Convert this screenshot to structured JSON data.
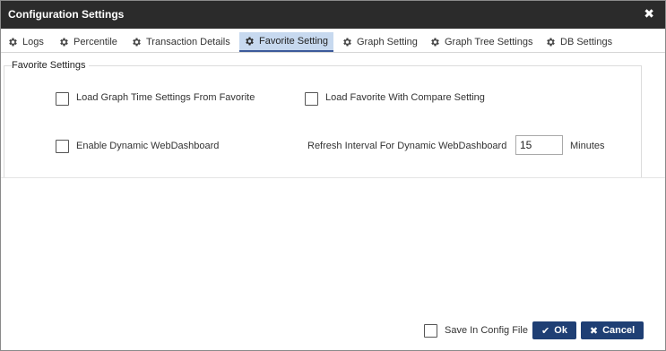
{
  "dialog": {
    "title": "Configuration Settings"
  },
  "tabs": [
    {
      "label": "Logs",
      "icon": "gear-icon"
    },
    {
      "label": "Percentile",
      "icon": "gear-icon"
    },
    {
      "label": "Transaction Details",
      "icon": "gear-icon"
    },
    {
      "label": "Favorite Setting",
      "icon": "gear-icon",
      "active": true
    },
    {
      "label": "Graph Setting",
      "icon": "gear-icon"
    },
    {
      "label": "Graph Tree Settings",
      "icon": "gear-icon"
    },
    {
      "label": "DB Settings",
      "icon": "gear-icon"
    }
  ],
  "favorite": {
    "section_title": "Favorite Settings",
    "load_time_label": "Load Graph Time Settings From Favorite",
    "load_compare_label": "Load Favorite With Compare Setting",
    "enable_dashboard_label": "Enable Dynamic WebDashboard",
    "refresh_label": "Refresh Interval For Dynamic WebDashboard",
    "refresh_value": "15",
    "refresh_unit": "Minutes"
  },
  "footer": {
    "save_config_label": "Save In Config File",
    "ok_label": "Ok",
    "cancel_label": "Cancel"
  },
  "colors": {
    "titlebar": "#2b2b2b",
    "active_tab": "#c7d9ef",
    "button": "#1f3f74"
  }
}
